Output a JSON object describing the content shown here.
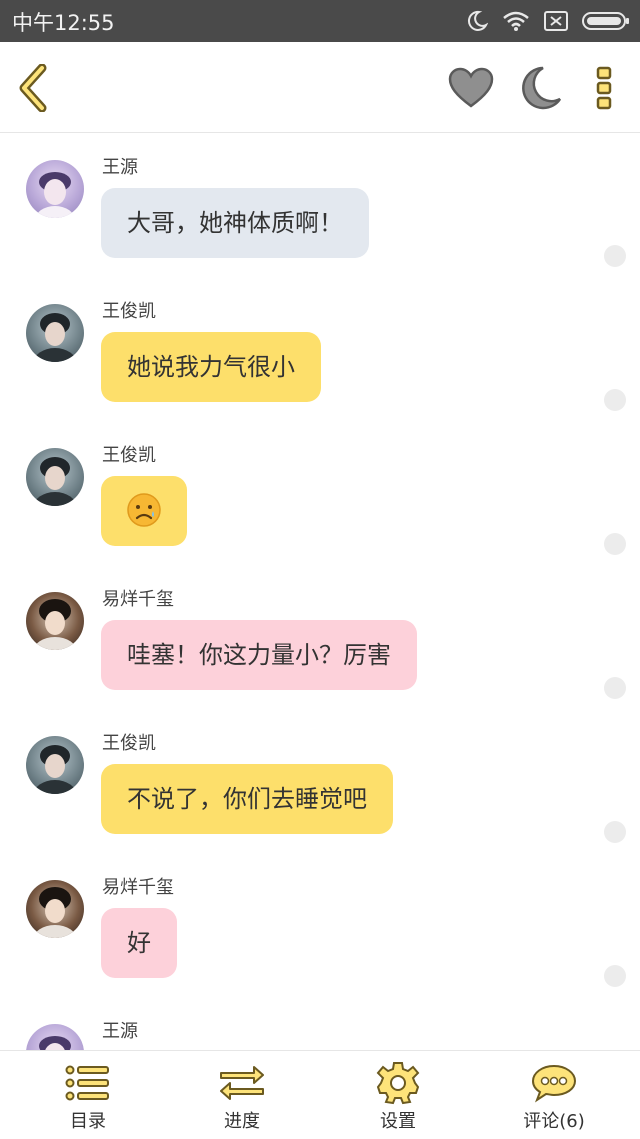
{
  "status_bar": {
    "time": "中午12:55"
  },
  "top_bar": {
    "back_icon": "back-chevron-icon",
    "heart_icon": "heart-icon",
    "moon_icon": "moon-icon",
    "more_icon": "more-dots-icon"
  },
  "messages": [
    {
      "name": "王源",
      "text": "大哥，她神体质啊！",
      "bubble_color": "#e3e8ef"
    },
    {
      "name": "王俊凯",
      "text": "她说我力气很小",
      "bubble_color": "#fddf6b"
    },
    {
      "name": "王俊凯",
      "text": "😟",
      "bubble_color": "#fddf6b"
    },
    {
      "name": "易烊千玺",
      "text": "哇塞！你这力量小？厉害",
      "bubble_color": "#fdd1da"
    },
    {
      "name": "王俊凯",
      "text": "不说了，你们去睡觉吧",
      "bubble_color": "#fddf6b"
    },
    {
      "name": "易烊千玺",
      "text": "好",
      "bubble_color": "#fdd1da"
    },
    {
      "name": "王源",
      "text": "",
      "bubble_color": "#e3e8ef"
    }
  ],
  "bottom_bar": {
    "tabs": [
      {
        "label": "目录",
        "icon": "list-icon"
      },
      {
        "label": "进度",
        "icon": "arrows-swap-icon"
      },
      {
        "label": "设置",
        "icon": "gear-icon"
      },
      {
        "label": "评论(6)",
        "icon": "comment-bubble-icon"
      }
    ]
  },
  "colors": {
    "accent_yellow": "#fddf6b",
    "icon_outline": "#7a6a2e",
    "status_bar": "#4a4a4a"
  }
}
